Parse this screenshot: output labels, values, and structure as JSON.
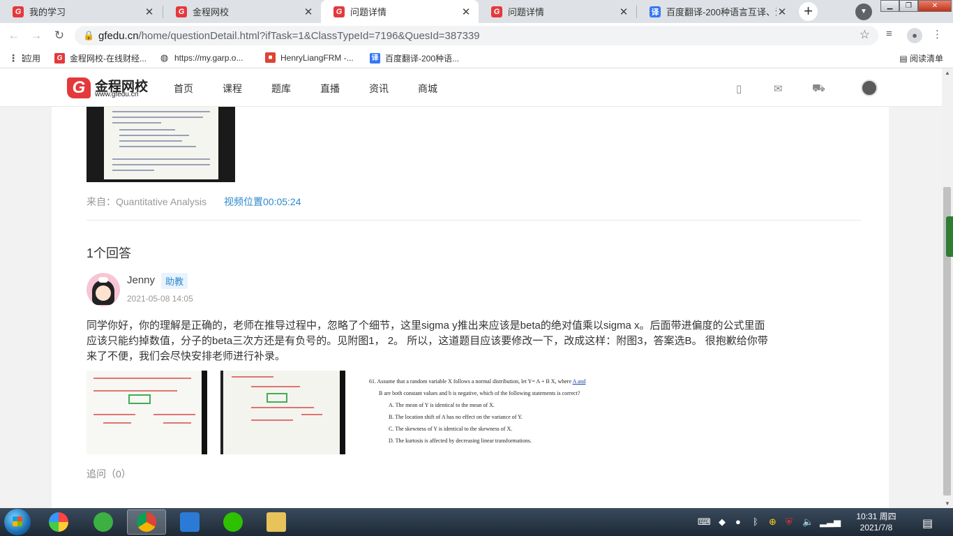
{
  "browser": {
    "tabs": [
      {
        "title": "我的学习",
        "icon": "G",
        "active": false
      },
      {
        "title": "金程网校",
        "icon": "G",
        "active": false
      },
      {
        "title": "问题详情",
        "icon": "G",
        "active": true
      },
      {
        "title": "问题详情",
        "icon": "G",
        "active": false
      },
      {
        "title": "百度翻译-200种语言互译、沟",
        "icon": "译",
        "active": false
      }
    ],
    "tab_close": "✕",
    "new_tab": "+",
    "url_host": "gfedu.cn",
    "url_path": "/home/questionDetail.html?ifTask=1&ClassTypeId=7196&QuesId=387339",
    "bookmarks": [
      {
        "label": "应用",
        "icon": "apps-grid-icon"
      },
      {
        "label": "金程网校-在线财经...",
        "icon": "G"
      },
      {
        "label": "https://my.garp.o...",
        "icon": "globe-icon"
      },
      {
        "label": "HenryLiangFRM -...",
        "icon": "bookmark-red-icon"
      },
      {
        "label": "百度翻译-200种语...",
        "icon": "译"
      }
    ],
    "reading_list": "阅读清单"
  },
  "site": {
    "logo_name": "金程网校",
    "logo_domain": "www.gfedu.cn",
    "logo_mark": "G",
    "nav": [
      "首页",
      "课程",
      "题库",
      "直播",
      "资讯",
      "商城"
    ]
  },
  "question": {
    "source": "来自：Quantitative Analysis",
    "video_position": "视频位置00:05:24"
  },
  "answers": {
    "count_label": "1个回答",
    "author": "Jenny",
    "role": "助教",
    "time": "2021-05-08 14:05",
    "text": "同学你好，你的理解是正确的，老师在推导过程中，忽略了个细节，这里sigma y推出来应该是beta的绝对值乘以sigma x。后面带进偏度的公式里面应该只能约掉数值，分子的beta三次方还是有负号的。见附图1， 2。 所以，这道题目应该要修改一下，改成这样：附图3，答案选B。 很抱歉给你带来了不便，我们会尽快安排老师进行补录。",
    "attachment3": {
      "q1_pre": "61.   Assume that a random variable X follows a normal distribution, let Y= A + B X, where ",
      "q1_link": "A and",
      "q2": "B are both constant values and b is negative, which of the following statements is correct?",
      "options": [
        "A.   The mean of Y is identical to the mean of X.",
        "B.   The location shift of A has no effect on the variance of Y.",
        "C.   The skewness of Y is identical to the skewness of X.",
        "D.   The kurtosis is affected by decreasing linear transformations."
      ]
    },
    "followup": "追问（0）"
  },
  "taskbar": {
    "time": "10:31 周四",
    "date": "2021/7/8"
  },
  "colors": {
    "brand_red": "#e4393c",
    "link_blue": "#2e89cc"
  }
}
